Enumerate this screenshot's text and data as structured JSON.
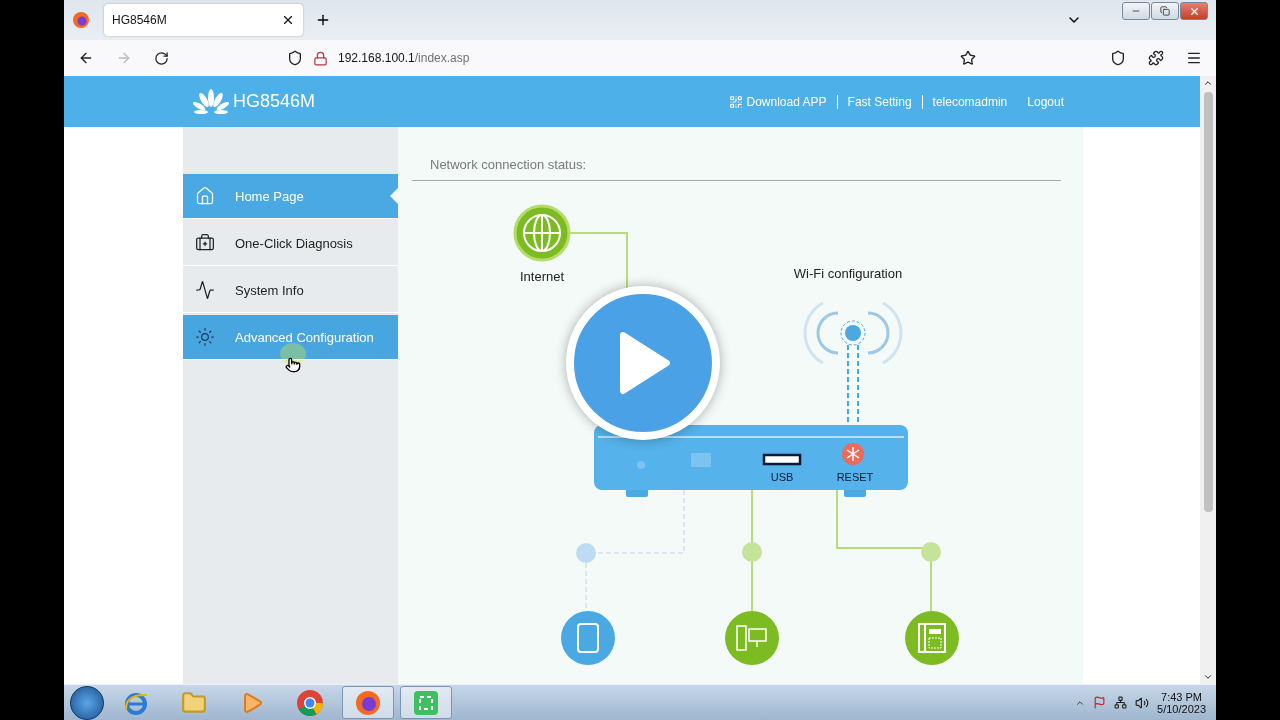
{
  "browser": {
    "tab": {
      "title": "HG8546M"
    },
    "url": {
      "host": "192.168.100.1",
      "path": "/index.asp"
    }
  },
  "header": {
    "model": "HG8546M",
    "links": [
      {
        "label": "Download APP",
        "kind": "qr"
      },
      {
        "label": "Fast Setting",
        "kind": "plain"
      },
      {
        "label": "telecomadmin",
        "kind": "plain"
      },
      {
        "label": "Logout",
        "kind": "plain"
      }
    ]
  },
  "sidebar": {
    "items": [
      {
        "label": "Home Page",
        "kind": "home",
        "selected": true,
        "hovered": false
      },
      {
        "label": "One-Click Diagnosis",
        "kind": "diagnosis",
        "selected": false,
        "hovered": false
      },
      {
        "label": "System Info",
        "kind": "info",
        "selected": false,
        "hovered": false
      },
      {
        "label": "Advanced Configuration",
        "kind": "advanced",
        "selected": false,
        "hovered": true
      }
    ]
  },
  "content": {
    "title": "Network connection status:",
    "internet_label": "Internet",
    "wifi_label": "Wi-Fi configuration",
    "usb_label": "USB",
    "reset_label": "RESET"
  },
  "taskbar": {
    "apps": [
      {
        "kind": "ie",
        "active": false
      },
      {
        "kind": "folder",
        "active": false
      },
      {
        "kind": "media",
        "active": false
      },
      {
        "kind": "chrome",
        "active": false
      },
      {
        "kind": "firefox",
        "active": true
      },
      {
        "kind": "capture",
        "active": true
      }
    ],
    "time": "7:43 PM",
    "date": "5/10/2023"
  }
}
